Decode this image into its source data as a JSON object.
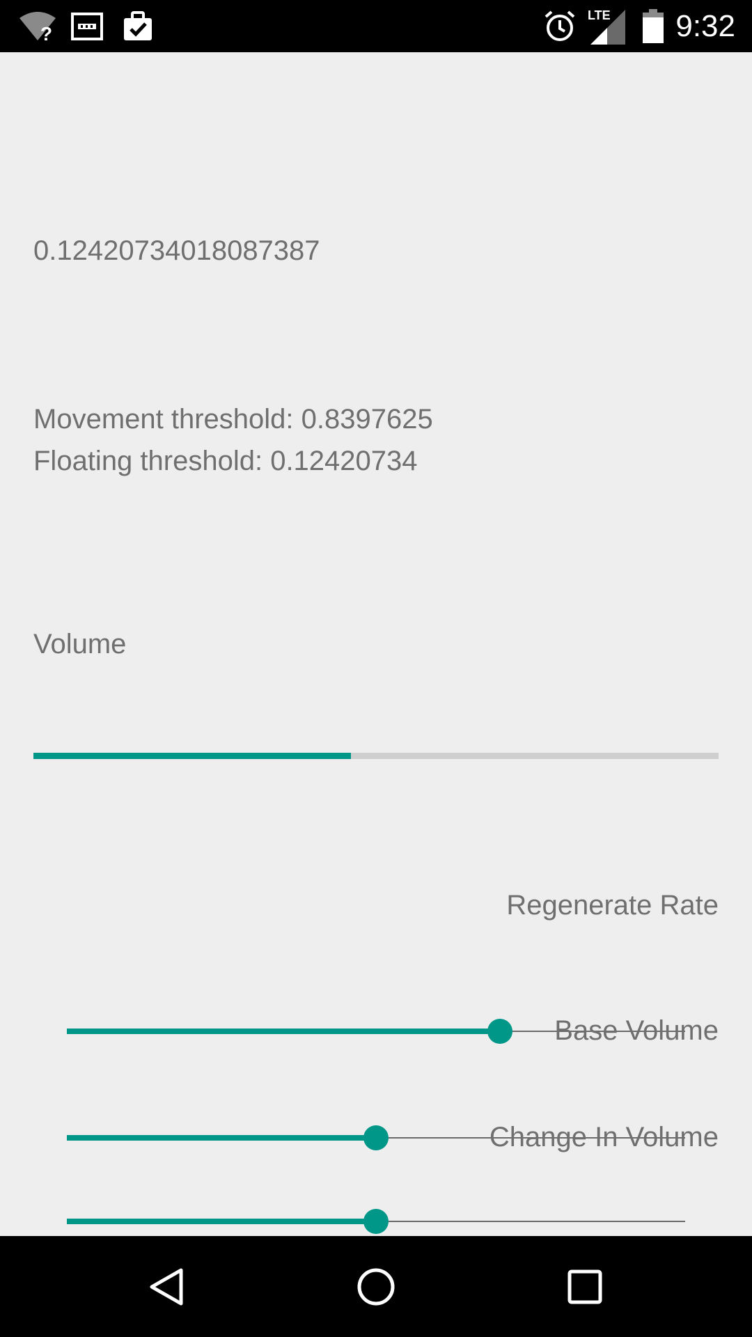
{
  "status_bar": {
    "time": "9:32",
    "network_label": "LTE",
    "icons": [
      "wifi-unknown-icon",
      "sim-card-icon",
      "clipboard-check-icon",
      "alarm-icon",
      "cell-signal-icon",
      "battery-icon"
    ]
  },
  "main": {
    "random_value": "0.12420734018087387",
    "movement_threshold": "Movement threshold: 0.8397625",
    "floating_threshold": "Floating threshold: 0.12420734",
    "volume_label": "Volume",
    "volume_progress": 0.463
  },
  "sliders": {
    "regenerate_rate": {
      "label": "Regenerate Rate",
      "value": 0.7
    },
    "base_volume": {
      "label": "Base Volume",
      "value": 0.5
    },
    "change_in_volume": {
      "label": "Change In Volume",
      "value": 0.5
    }
  },
  "colors": {
    "accent": "#009688",
    "text": "#6f6f6f",
    "background": "#eeeeee",
    "track": "#cfcfcf"
  },
  "nav_bar": {
    "icons": [
      "back-icon",
      "home-icon",
      "recents-icon"
    ]
  }
}
